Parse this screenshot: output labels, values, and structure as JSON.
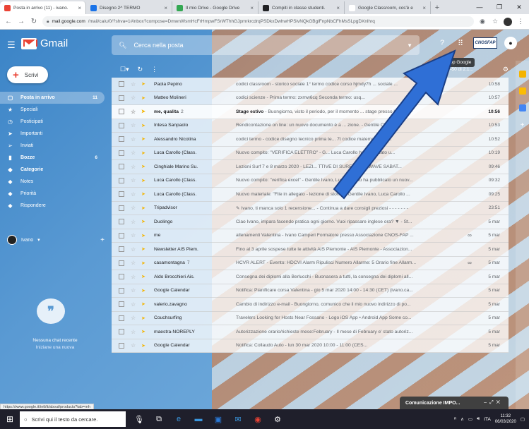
{
  "browser": {
    "tabs": [
      {
        "title": "Posta in arrivo (11) - ivano.",
        "color": "#ea4335",
        "active": true
      },
      {
        "title": "Disegno 2^ TERMO",
        "color": "#1a73e8",
        "active": false
      },
      {
        "title": "Il mio Drive - Google Drive",
        "color": "#34a853",
        "active": false
      },
      {
        "title": "Compiti in classe studenti.",
        "color": "#202124",
        "active": false
      },
      {
        "title": "Google Classroom, cos'è e",
        "color": "#ffffff",
        "active": false
      }
    ],
    "new_tab": "+",
    "url_host": "mail.google.com",
    "url_path": "/mail/ca/u/0/?shva=1#inbox?compose=DmwnWsmHcFrHmpwFSrWThhGJpmrkrcdrqPSDkxDwhwHPSlvNQkGBglFnpNbCFhMsSLpgDXnlhrq"
  },
  "gmail": {
    "logo_text": "Gmail",
    "search_placeholder": "Cerca nella posta",
    "brand": "CNOSFAP",
    "tooltip": "App Google",
    "compose_label": "Scrivi",
    "pager": "1–50 di 2.1...",
    "nav": [
      {
        "label": "Posta in arrivo",
        "icon": "inbox-icon",
        "glyph": "▢",
        "count": "11",
        "selected": true,
        "bold": true
      },
      {
        "label": "Speciali",
        "icon": "star-icon",
        "glyph": "★",
        "count": "",
        "selected": false,
        "bold": false
      },
      {
        "label": "Posticipati",
        "icon": "clock-icon",
        "glyph": "◷",
        "count": "",
        "selected": false,
        "bold": false
      },
      {
        "label": "Importanti",
        "icon": "important-icon",
        "glyph": "➤",
        "count": "",
        "selected": false,
        "bold": false
      },
      {
        "label": "Inviati",
        "icon": "send-icon",
        "glyph": "➢",
        "count": "",
        "selected": false,
        "bold": false
      },
      {
        "label": "Bozze",
        "icon": "draft-icon",
        "glyph": "▮",
        "count": "6",
        "selected": false,
        "bold": true
      },
      {
        "label": "Categorie",
        "icon": "label-icon",
        "glyph": "◆",
        "count": "",
        "selected": false,
        "bold": true
      },
      {
        "label": "Notes",
        "icon": "label-icon",
        "glyph": "◆",
        "count": "",
        "selected": false,
        "bold": false
      },
      {
        "label": "Priorità",
        "icon": "label-icon",
        "glyph": "◆",
        "count": "",
        "selected": false,
        "bold": false
      },
      {
        "label": "Rispondere",
        "icon": "label-icon",
        "glyph": "◆",
        "count": "",
        "selected": false,
        "bold": false
      }
    ],
    "hangouts_user": "Ivano",
    "no_chat": "Nessuna chat recente",
    "start_chat": "Iniziane una nuova",
    "emails": [
      {
        "from": "Paola Pepino",
        "n": "",
        "subject": "",
        "preview": "codici classroom - storico sociale 1° termo codice corso hjmdy7h ... sociale ...",
        "time": "10:58",
        "unread": false,
        "att": ""
      },
      {
        "from": "Matteo Molineri",
        "n": "",
        "subject": "",
        "preview": "codici scienze - Prima termo: zxmw6cq Seconda termo: usq...",
        "time": "10:57",
        "unread": false,
        "att": ""
      },
      {
        "from": "me, qualita",
        "n": "2",
        "subject": "Stage estivo",
        "preview": " - Buongiorno, visto il periodo, per il momento ... stage presso la no...",
        "time": "10:56",
        "unread": true,
        "att": ""
      },
      {
        "from": "Intesa Sanpaolo",
        "n": "",
        "subject": "",
        "preview": "Rendicontazione on line: un nuovo documento è a ... zione. - Gentile Clien...",
        "time": "10:53",
        "unread": false,
        "att": ""
      },
      {
        "from": "Alessandro Nicotina",
        "n": "",
        "subject": "",
        "preview": "codici termo - codice disegno tecnico prima te... 7t codice matematica se...",
        "time": "10:52",
        "unread": false,
        "att": ""
      },
      {
        "from": "Luca Carollo (Class.",
        "n": "",
        "subject": "",
        "preview": "Nuovo compito: \"VERIFICA ELETTRO\" - G... Luca Carollo ha pubblicato u...",
        "time": "10:19",
        "unread": false,
        "att": ""
      },
      {
        "from": "Cinghiale Marino Su.",
        "n": "",
        "subject": "",
        "preview": "Lezioni Surf 7 e 8 marzo 2020 - LEZI... TTIVE DI SURF E SUP WAVE SABAT...",
        "time": "09:46",
        "unread": false,
        "att": ""
      },
      {
        "from": "Luca Carollo (Class.",
        "n": "",
        "subject": "",
        "preview": "Nuovo compito: \"verifica excel\" - Gentile Ivano, Luca Carollo ha pubblicato un nuov...",
        "time": "09:32",
        "unread": false,
        "att": ""
      },
      {
        "from": "Luca Carollo (Class.",
        "n": "",
        "subject": "",
        "preview": "Nuovo materiale: \"File in allegato - lezione di storia\" - Gentile Ivano, Luca Carollo ...",
        "time": "09:25",
        "unread": false,
        "att": ""
      },
      {
        "from": "Tripadvisor",
        "n": "",
        "subject": "",
        "preview": "✎ Ivano, ti manca solo 1 recensione... - Continua a dare consigli preziosi - - - - - - -",
        "time": "23:51",
        "unread": false,
        "att": ""
      },
      {
        "from": "Duolingo",
        "n": "",
        "subject": "",
        "preview": "Ciao Ivano, impara facendo pratica ogni giorno. Vuoi ripassare inglese ora? ▼ - St...",
        "time": "5 mar",
        "unread": false,
        "att": ""
      },
      {
        "from": "me",
        "n": "",
        "subject": "",
        "preview": "allenamenti Valentina - Ivano Camperi Formatore presso Associazione CNOS-FAP ...",
        "time": "5 mar",
        "unread": false,
        "att": "∞"
      },
      {
        "from": "Newsletter AIS Piem.",
        "n": "",
        "subject": "",
        "preview": "Fino al 3 aprile sospese tutte le attività AIS Piemonte - AIS Piemonte - Associazion...",
        "time": "5 mar",
        "unread": false,
        "att": ""
      },
      {
        "from": "casamontagna",
        "n": "7",
        "subject": "",
        "preview": "HCVR ALERT - Evento: HDCVI Alarm Ripulisci Numero Allarme: 5 Orario fine Allarm...",
        "time": "5 mar",
        "unread": false,
        "att": "∞"
      },
      {
        "from": "Aldo Brocchieri Ais.",
        "n": "",
        "subject": "",
        "preview": "Consegna dei diplomi alla Berlucchi - Buonasera a tutti, la consegna dei diplomi all...",
        "time": "5 mar",
        "unread": false,
        "att": ""
      },
      {
        "from": "Google Calendar",
        "n": "",
        "subject": "",
        "preview": "Notifica: Pianificare corsa Valentina - gio 5 mar 2020 14:00 - 14:30 (CET) (ivano.ca...",
        "time": "5 mar",
        "unread": false,
        "att": ""
      },
      {
        "from": "valerio.zavagno",
        "n": "",
        "subject": "",
        "preview": "Cambio di indirizzo e-mail - Buongiorno, comunico che il mio nuovo indirizzo di po...",
        "time": "5 mar",
        "unread": false,
        "att": ""
      },
      {
        "from": "Couchsurfing",
        "n": "",
        "subject": "",
        "preview": "Travelers Looking for Hosts Near Fossano - Logo iOS App • Android App Some co...",
        "time": "5 mar",
        "unread": false,
        "att": ""
      },
      {
        "from": "maestra-NOREPLY",
        "n": "",
        "subject": "",
        "preview": "Autorizzazione orario/richieste mese:February - Il mese di February e' stato autoriz...",
        "time": "5 mar",
        "unread": false,
        "att": ""
      },
      {
        "from": "Google Calendar",
        "n": "",
        "subject": "",
        "preview": "Notifica: Collaudo Auto - lun 30 mar 2020 10:00 - 11:00 (CES...",
        "time": "5 mar",
        "unread": false,
        "att": ""
      }
    ],
    "notification": "Comunicazione IMPO...",
    "status_url": "https://www.google.it/intl/it/about/products?tab=mh"
  },
  "taskbar": {
    "search_placeholder": "Scrivi qui il testo da cercare.",
    "lang": "ITA",
    "time": "11:32",
    "date": "06/03/2020"
  },
  "colors": {
    "arrow": "#2f6fd6",
    "stripe": "#f17a2a",
    "accent": "#ea4335"
  }
}
